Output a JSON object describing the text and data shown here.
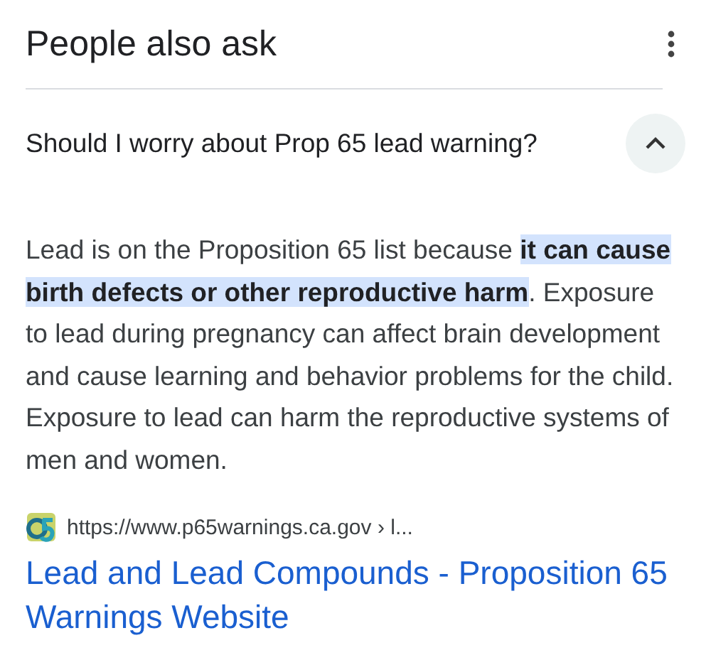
{
  "header": {
    "title": "People also ask"
  },
  "question": {
    "text": "Should I worry about Prop 65 lead warning?",
    "expanded": true
  },
  "answer": "Lead is on the Proposition 65 list because **it can cause birth defects or other reproductive harm**. Exposure to lead during pregnancy can affect brain development and cause learning and behavior problems for the child. Exposure to lead can harm the reproductive systems of men and women.",
  "source": {
    "url": "https://www.p65warnings.ca.gov › l...",
    "title": "Lead and Lead Compounds - Proposition 65 Warnings Website"
  }
}
